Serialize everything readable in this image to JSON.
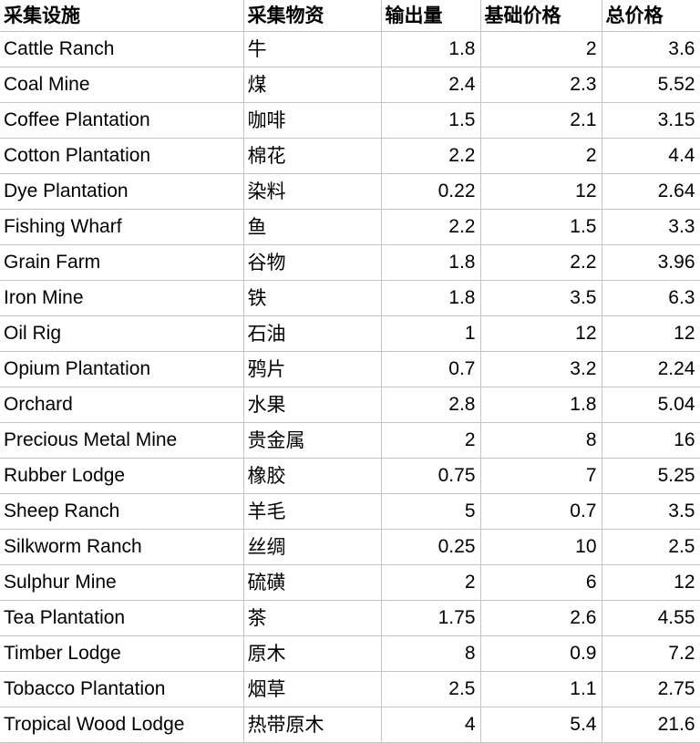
{
  "table": {
    "columns": [
      {
        "key": "facility",
        "label": "采集设施",
        "align": "left"
      },
      {
        "key": "goods",
        "label": "采集物资",
        "align": "left"
      },
      {
        "key": "output",
        "label": "输出量",
        "align": "right"
      },
      {
        "key": "base_price",
        "label": "基础价格",
        "align": "right"
      },
      {
        "key": "total_price",
        "label": "总价格",
        "align": "right"
      }
    ],
    "rows": [
      {
        "facility": "Cattle Ranch",
        "goods": "牛",
        "output": "1.8",
        "base_price": "2",
        "total_price": "3.6"
      },
      {
        "facility": "Coal Mine",
        "goods": "煤",
        "output": "2.4",
        "base_price": "2.3",
        "total_price": "5.52"
      },
      {
        "facility": "Coffee Plantation",
        "goods": "咖啡",
        "output": "1.5",
        "base_price": "2.1",
        "total_price": "3.15"
      },
      {
        "facility": "Cotton Plantation",
        "goods": "棉花",
        "output": "2.2",
        "base_price": "2",
        "total_price": "4.4"
      },
      {
        "facility": "Dye Plantation",
        "goods": "染料",
        "output": "0.22",
        "base_price": "12",
        "total_price": "2.64"
      },
      {
        "facility": "Fishing Wharf",
        "goods": "鱼",
        "output": "2.2",
        "base_price": "1.5",
        "total_price": "3.3"
      },
      {
        "facility": "Grain Farm",
        "goods": "谷物",
        "output": "1.8",
        "base_price": "2.2",
        "total_price": "3.96"
      },
      {
        "facility": "Iron Mine",
        "goods": "铁",
        "output": "1.8",
        "base_price": "3.5",
        "total_price": "6.3"
      },
      {
        "facility": "Oil Rig",
        "goods": "石油",
        "output": "1",
        "base_price": "12",
        "total_price": "12"
      },
      {
        "facility": "Opium Plantation",
        "goods": "鸦片",
        "output": "0.7",
        "base_price": "3.2",
        "total_price": "2.24"
      },
      {
        "facility": "Orchard",
        "goods": "水果",
        "output": "2.8",
        "base_price": "1.8",
        "total_price": "5.04"
      },
      {
        "facility": "Precious Metal Mine",
        "goods": "贵金属",
        "output": "2",
        "base_price": "8",
        "total_price": "16"
      },
      {
        "facility": "Rubber Lodge",
        "goods": "橡胶",
        "output": "0.75",
        "base_price": "7",
        "total_price": "5.25"
      },
      {
        "facility": "Sheep Ranch",
        "goods": "羊毛",
        "output": "5",
        "base_price": "0.7",
        "total_price": "3.5"
      },
      {
        "facility": "Silkworm Ranch",
        "goods": "丝绸",
        "output": "0.25",
        "base_price": "10",
        "total_price": "2.5"
      },
      {
        "facility": "Sulphur Mine",
        "goods": "硫磺",
        "output": "2",
        "base_price": "6",
        "total_price": "12"
      },
      {
        "facility": "Tea Plantation",
        "goods": "茶",
        "output": "1.75",
        "base_price": "2.6",
        "total_price": "4.55"
      },
      {
        "facility": "Timber Lodge",
        "goods": "原木",
        "output": "8",
        "base_price": "0.9",
        "total_price": "7.2"
      },
      {
        "facility": "Tobacco Plantation",
        "goods": "烟草",
        "output": "2.5",
        "base_price": "1.1",
        "total_price": "2.75"
      },
      {
        "facility": "Tropical Wood Lodge",
        "goods": "热带原木",
        "output": "4",
        "base_price": "5.4",
        "total_price": "21.6"
      }
    ]
  },
  "style": {
    "gridline_color": "#c4c4c4",
    "background_color": "#ffffff",
    "text_color": "#000000"
  }
}
